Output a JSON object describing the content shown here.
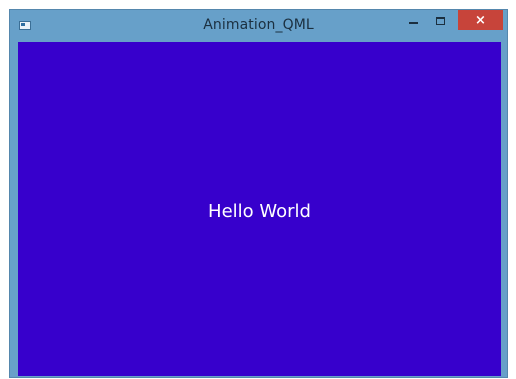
{
  "window": {
    "title": "Animation_QML",
    "app_icon": "window-app-icon",
    "controls": {
      "minimize_icon": "minimize-icon",
      "maximize_icon": "maximize-icon",
      "close_label": "×"
    }
  },
  "content": {
    "text": "Hello World",
    "background_color": "#3700cc",
    "text_color": "#ffffff"
  },
  "colors": {
    "titlebar": "#67a0c9",
    "close_button": "#c7443a"
  }
}
